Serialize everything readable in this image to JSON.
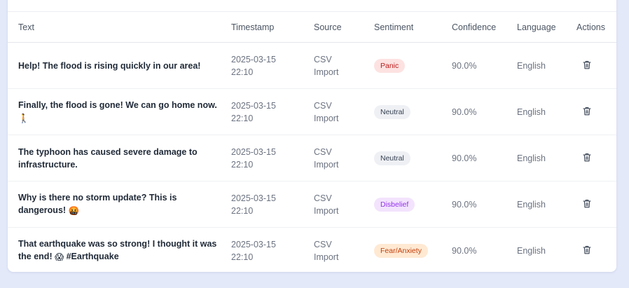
{
  "table": {
    "headers": {
      "text": "Text",
      "timestamp": "Timestamp",
      "source": "Source",
      "sentiment": "Sentiment",
      "confidence": "Confidence",
      "language": "Language",
      "actions": "Actions"
    },
    "rows": [
      {
        "text": "Help! The flood is rising quickly in our area!",
        "date": "2025-03-15",
        "time": "22:10",
        "source_1": "CSV",
        "source_2": "Import",
        "sentiment": "Panic",
        "confidence": "90.0%",
        "language": "English"
      },
      {
        "text": "Finally, the flood is gone! We can go home now.",
        "emoji": "🚶",
        "date": "2025-03-15",
        "time": "22:10",
        "source_1": "CSV",
        "source_2": "Import",
        "sentiment": "Neutral",
        "confidence": "90.0%",
        "language": "English"
      },
      {
        "text": "The typhoon has caused severe damage to infrastructure.",
        "date": "2025-03-15",
        "time": "22:10",
        "source_1": "CSV",
        "source_2": "Import",
        "sentiment": "Neutral",
        "confidence": "90.0%",
        "language": "English"
      },
      {
        "text": "Why is there no storm update? This is dangerous!",
        "emoji": "🤬",
        "date": "2025-03-15",
        "time": "22:10",
        "source_1": "CSV",
        "source_2": "Import",
        "sentiment": "Disbelief",
        "confidence": "90.0%",
        "language": "English"
      },
      {
        "text": "That earthquake was so strong! I thought it was the end!",
        "emoji": "😱",
        "hashtag": "#Earthquake",
        "date": "2025-03-15",
        "time": "22:10",
        "source_1": "CSV",
        "source_2": "Import",
        "sentiment": "Fear/Anxiety",
        "confidence": "90.0%",
        "language": "English"
      }
    ]
  },
  "icons": {
    "delete": "trash-icon"
  },
  "colors": {
    "page_bg": "#e3e9f9",
    "panic": "#b91c1c",
    "neutral": "#374151",
    "disbelief": "#9333ea",
    "fear": "#c2410c"
  }
}
